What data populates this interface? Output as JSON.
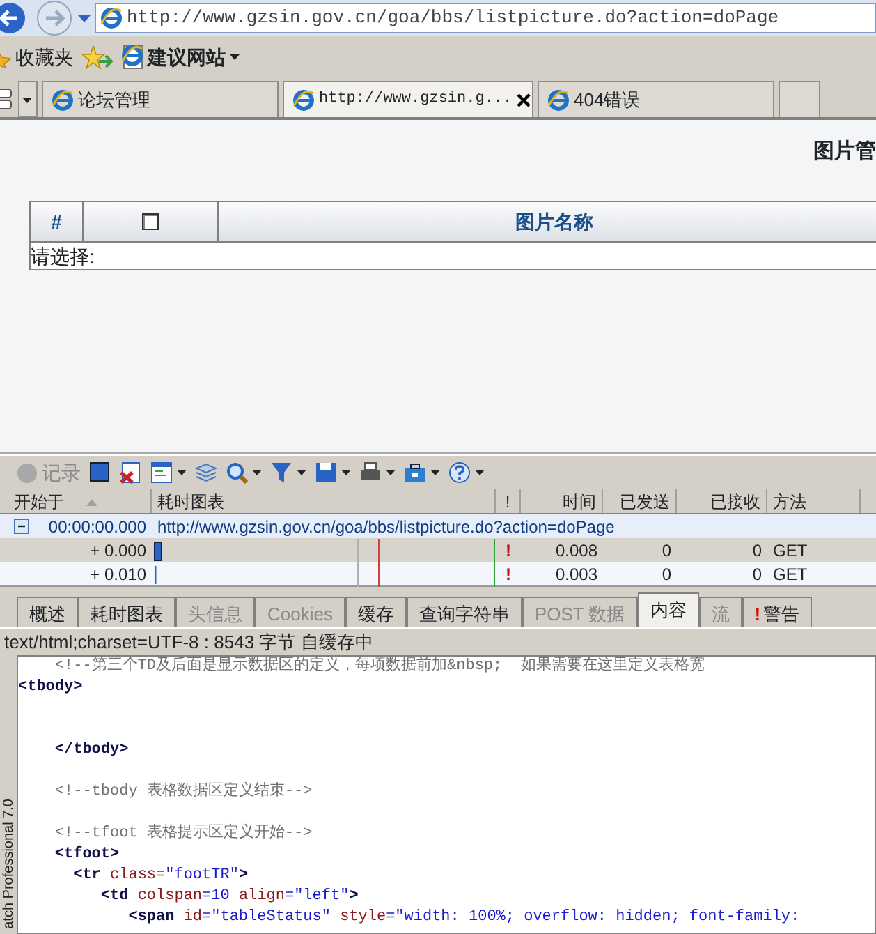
{
  "browser": {
    "address": "http://www.gzsin.gov.cn/goa/bbs/listpicture.do?action=doPage",
    "favorites": {
      "label": "收藏夹",
      "suggested": "建议网站"
    },
    "tabs": [
      {
        "label": "论坛管理",
        "selected": false,
        "closable": false
      },
      {
        "label": "http://www.gzsin.g...",
        "selected": true,
        "closable": true
      },
      {
        "label": "404错误",
        "selected": false,
        "closable": false
      }
    ]
  },
  "page": {
    "title": "图片管",
    "columns": [
      "#",
      "",
      "图片名称"
    ],
    "header_checkbox": {
      "checked": false
    },
    "footer": "请选择:"
  },
  "httpwatch": {
    "record": {
      "label": "记录",
      "disabled": true
    },
    "columns": [
      "开始于",
      "耗时图表",
      "!",
      "时间",
      "已发送",
      "已接收",
      "方法"
    ],
    "group": {
      "expanded": true,
      "started": "00:00:00.000",
      "url": "http://www.gzsin.gov.cn/goa/bbs/listpicture.do?action=doPage"
    },
    "rows": [
      {
        "offset": "+ 0.000",
        "warning": "!",
        "time": "0.008",
        "sent": "0",
        "received": "0",
        "method": "GET",
        "selected": true,
        "level": 0.02
      },
      {
        "offset": "+ 0.010",
        "warning": "!",
        "time": "0.003",
        "sent": "0",
        "received": "0",
        "method": "GET",
        "selected": false,
        "level": 0.005
      }
    ],
    "tabs": [
      {
        "label": "概述",
        "selected": false,
        "disabled": false
      },
      {
        "label": "耗时图表",
        "selected": false,
        "disabled": false
      },
      {
        "label": "头信息",
        "selected": false,
        "disabled": true
      },
      {
        "label": "Cookies",
        "selected": false,
        "disabled": true
      },
      {
        "label": "缓存",
        "selected": false,
        "disabled": false
      },
      {
        "label": "查询字符串",
        "selected": false,
        "disabled": false
      },
      {
        "label": "POST 数据",
        "selected": false,
        "disabled": true
      },
      {
        "label": "内容",
        "selected": true,
        "disabled": false
      },
      {
        "label": "流",
        "selected": false,
        "disabled": true
      },
      {
        "label": "警告",
        "selected": false,
        "disabled": false,
        "prefix": "!"
      }
    ],
    "status": "text/html;charset=UTF-8 : 8543 字节 自缓存中",
    "side_label": "atch Professional 7.0",
    "code": [
      {
        "kind": "code",
        "parts": [
          {
            "kind": "comment",
            "text": "    <!--第三个TD及后面是显示数据区的定义，每项数据前加&nbsp;  如果需要在这里定义表格宽"
          }
        ]
      },
      {
        "kind": "code",
        "parts": [
          {
            "kind": "tag",
            "text": "<tbody>"
          }
        ]
      },
      {
        "kind": "blank"
      },
      {
        "kind": "blank"
      },
      {
        "kind": "code",
        "parts": [
          {
            "kind": "tag",
            "text": "    </tbody>"
          }
        ]
      },
      {
        "kind": "blank"
      },
      {
        "kind": "code",
        "parts": [
          {
            "kind": "comment",
            "text": "    <!--tbody 表格数据区定义结束-->"
          }
        ]
      },
      {
        "kind": "blank"
      },
      {
        "kind": "code",
        "parts": [
          {
            "kind": "comment",
            "text": "    <!--tfoot 表格提示区定义开始-->"
          }
        ]
      },
      {
        "kind": "code",
        "parts": [
          {
            "kind": "tag",
            "text": "    <tfoot>"
          }
        ]
      },
      {
        "kind": "code",
        "parts": [
          {
            "kind": "tag",
            "text": "      <tr "
          },
          {
            "kind": "attr",
            "text": "class="
          },
          {
            "kind": "value",
            "text": "\"footTR\""
          },
          {
            "kind": "tag",
            "text": ">"
          }
        ]
      },
      {
        "kind": "code",
        "parts": [
          {
            "kind": "tag",
            "text": "         <td "
          },
          {
            "kind": "attr",
            "text": "colspan"
          },
          {
            "kind": "value",
            "text": "=10 "
          },
          {
            "kind": "attr",
            "text": "align"
          },
          {
            "kind": "value",
            "text": "=\"left\""
          },
          {
            "kind": "tag",
            "text": ">"
          }
        ]
      },
      {
        "kind": "code",
        "parts": [
          {
            "kind": "tag",
            "text": "            <span "
          },
          {
            "kind": "attr",
            "text": "id"
          },
          {
            "kind": "value",
            "text": "=\"tableStatus\" "
          },
          {
            "kind": "attr",
            "text": "style"
          },
          {
            "kind": "value",
            "text": "=\"width: 100%; overflow: hidden; font-family:"
          }
        ]
      }
    ]
  }
}
